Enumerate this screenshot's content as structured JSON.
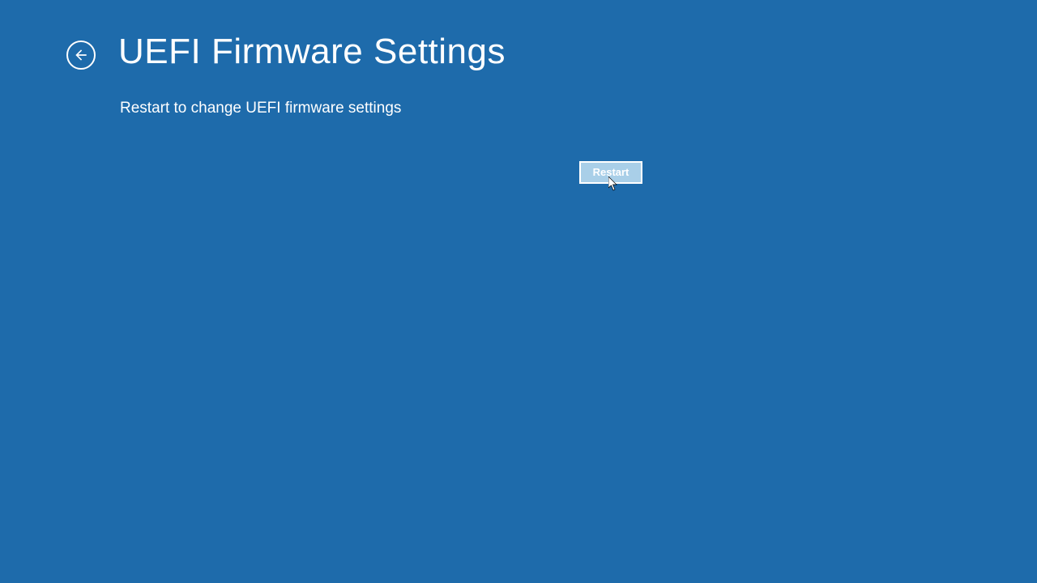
{
  "header": {
    "title": "UEFI Firmware Settings"
  },
  "body": {
    "description": "Restart to change UEFI firmware settings"
  },
  "actions": {
    "restart_label": "Restart"
  }
}
